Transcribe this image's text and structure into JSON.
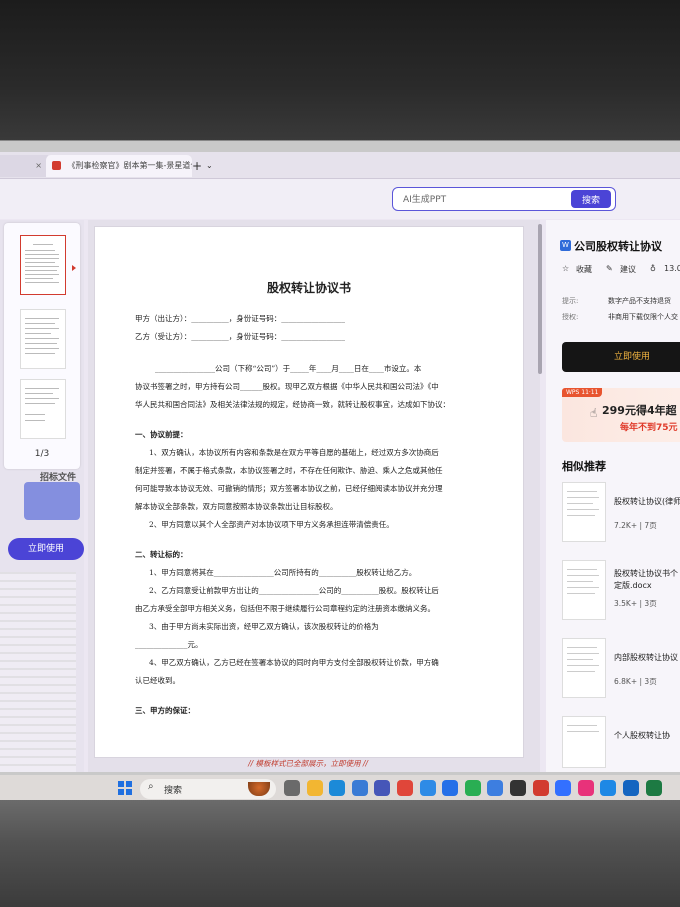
{
  "browser": {
    "tabs": [
      {
        "label": "",
        "close": "×"
      },
      {
        "label": "《刑事检察官》剧本第一集-景星道合",
        "close": "×"
      }
    ],
    "new_tab": "+",
    "tab_menu": "⌄"
  },
  "toolbar": {
    "search_placeholder": "AI生成PPT",
    "search_button": "搜索"
  },
  "left_panel": {
    "page_indicator": "1/3",
    "extra_text": "招标文件",
    "use_button": "立即使用"
  },
  "document": {
    "title": "股权转让协议书",
    "party_a": "甲方（出让方）：__________，身份证号码：_________________",
    "party_b": "乙方（受让方）：__________，身份证号码：_________________",
    "intro_1": "________________公司（下称“公司”）于_____年____月____日在____市设立。本",
    "intro_2": "协议书签署之时，甲方持有公司______股权。现甲乙双方根据《中华人民共和国公司法》《中",
    "intro_3": "华人民共和国合同法》及相关法律法规的规定，经协商一致，就转让股权事宜，达成如下协议：",
    "s1_title": "一、协议前提：",
    "s1_p1_1": "1、双方确认，本协议所有内容和条款是在双方平等自愿的基础上，经过双方多次协商后",
    "s1_p1_2": "制定并签署，不属于格式条款，本协议签署之时，不存在任何欺诈、胁迫、乘人之危或其他任",
    "s1_p1_3": "何可能导致本协议无效、可撤销的情形；双方签署本协议之前，已经仔细阅读本协议并充分理",
    "s1_p1_4": "解本协议全部条款，双方同意按照本协议条款出让目标股权。",
    "s1_p2": "2、甲方同意以其个人全部资产对本协议项下甲方义务承担连带清偿责任。",
    "s2_title": "二、转让标的：",
    "s2_p1": "1、甲方同意将其在________________公司所持有的__________股权转让给乙方。",
    "s2_p2_1": "2、乙方同意受让前款甲方出让的________________公司的__________股权。股权转让后",
    "s2_p2_2": "由乙方承受全部甲方相关义务，包括但不限于继续履行公司章程约定的注册资本缴纳义务。",
    "s2_p3_1": "3、由于甲方尚未实际出资，经甲乙双方确认，该次股权转让的价格为",
    "s2_p3_2": "______________元。",
    "s2_p4_1": "4、甲乙双方确认，乙方已经在签署本协议的同时向甲方支付全部股权转让价款，甲方确",
    "s2_p4_2": "认已经收到。",
    "s3_title": "三、甲方的保证：",
    "footer": "// 模板样式已全部展示，立即使用 //"
  },
  "right_panel": {
    "doc_icon": "W",
    "title": "公司股权转让协议",
    "favorite": "收藏",
    "suggest": "建议",
    "count": "13.0",
    "meta": [
      {
        "key": "提示:",
        "value": "数字产品不支持退货"
      },
      {
        "key": "授权:",
        "value": "非商用下载仅限个人交"
      }
    ],
    "use_button": "立即使用",
    "promo_badge": "WPS 11·11",
    "promo_main": "299元得4年超",
    "promo_sub": "每年不到75元",
    "recommend_title": "相似推荐",
    "recommendations": [
      {
        "title": "股权转让协议(律师",
        "title2": "",
        "meta": "7.2K+ | 7页"
      },
      {
        "title": "股权转让协议书个",
        "title2": "定版.docx",
        "meta": "3.5K+ | 3页"
      },
      {
        "title": "内部股权转让协议",
        "title2": "",
        "meta": "6.8K+ | 3页"
      },
      {
        "title": "个人股权转让协",
        "title2": "",
        "meta": ""
      }
    ]
  },
  "taskbar": {
    "search_text": "搜索",
    "apps": [
      {
        "name": "task-view",
        "color": "#6a6a6a"
      },
      {
        "name": "file-explorer",
        "color": "#f2b632"
      },
      {
        "name": "edge",
        "color": "#1c8ad8"
      },
      {
        "name": "store",
        "color": "#3a7bd5"
      },
      {
        "name": "mail",
        "color": "#4656b8"
      },
      {
        "name": "app-red",
        "color": "#e0463a"
      },
      {
        "name": "cloud",
        "color": "#2e8be6"
      },
      {
        "name": "browser-blue",
        "color": "#2670e8"
      },
      {
        "name": "wechat",
        "color": "#2aae53"
      },
      {
        "name": "browser-circle",
        "color": "#3d7ee0"
      },
      {
        "name": "app-dark",
        "color": "#333333"
      },
      {
        "name": "wps",
        "color": "#d23b2f"
      },
      {
        "name": "feishu",
        "color": "#3370ff"
      },
      {
        "name": "app-pink",
        "color": "#e8327a"
      },
      {
        "name": "app-blue-2",
        "color": "#1e88e5"
      },
      {
        "name": "app-blue-3",
        "color": "#1565c0"
      },
      {
        "name": "excel",
        "color": "#1d7a43"
      }
    ]
  }
}
